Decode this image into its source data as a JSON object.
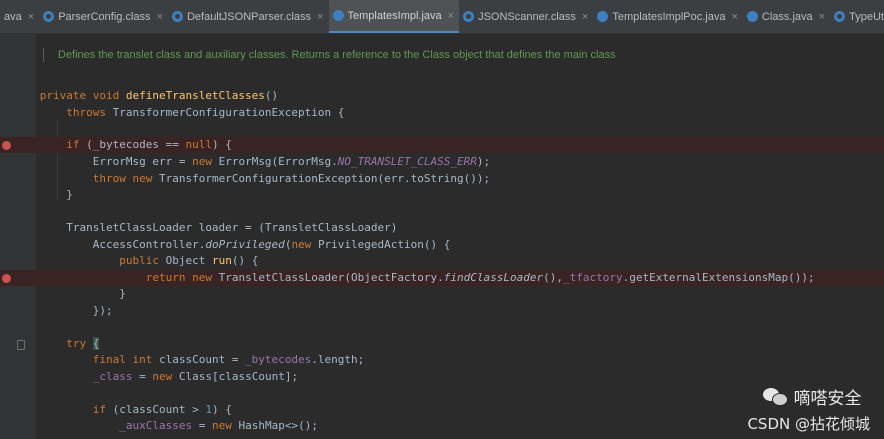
{
  "tabs": [
    {
      "label": "ava",
      "icon": "none",
      "active": false
    },
    {
      "label": "ParserConfig.class",
      "icon": "class-file-icon",
      "active": false
    },
    {
      "label": "DefaultJSONParser.class",
      "icon": "class-file-icon",
      "active": false
    },
    {
      "label": "TemplatesImpl.java",
      "icon": "java-file-icon",
      "active": true
    },
    {
      "label": "JSONScanner.class",
      "icon": "class-file-icon",
      "active": false
    },
    {
      "label": "TemplatesImplPoc.java",
      "icon": "java-file-icon",
      "active": false
    },
    {
      "label": "Class.java",
      "icon": "java-file-icon",
      "active": false
    },
    {
      "label": "TypeUtils.class",
      "icon": "class-file-icon",
      "active": false
    }
  ],
  "close_glyph": "×",
  "doc_comment": "Defines the translet class and auxiliary classes. Returns a reference to the Class object that defines the main class",
  "code": {
    "l1a": "private void ",
    "l1b": "defineTransletClasses",
    "l1c": "()",
    "l2a": "    throws ",
    "l2b": "TransformerConfigurationException {",
    "l3a": "    if ",
    "l3b": "(_bytecodes == ",
    "l3c": "null",
    "l3d": ") {",
    "l4a": "        ErrorMsg err = ",
    "l4b": "new ",
    "l4c": "ErrorMsg(ErrorMsg.",
    "l4d": "NO_TRANSLET_CLASS_ERR",
    "l4e": ");",
    "l5a": "        ",
    "l5b": "throw new ",
    "l5c": "TransformerConfigurationException(err.toString());",
    "l6": "    }",
    "l7": "    TransletClassLoader loader = (TransletClassLoader)",
    "l8a": "        AccessController.",
    "l8b": "doPrivileged",
    "l8c": "(",
    "l8d": "new ",
    "l8e": "PrivilegedAction() {",
    "l9a": "            ",
    "l9b": "public ",
    "l9c": "Object ",
    "l9d": "run",
    "l9e": "() {",
    "l10a": "                ",
    "l10b": "return new ",
    "l10c": "TransletClassLoader(ObjectFactory.",
    "l10d": "findClassLoader",
    "l10e": "(),",
    "l10f": "_tfactory",
    "l10g": ".getExternalExtensionsMap());",
    "l11": "            }",
    "l12": "        });",
    "l13a": "    ",
    "l13b": "try ",
    "l13c": "{",
    "l14a": "        ",
    "l14b": "final int ",
    "l14c": "classCount = ",
    "l14d": "_bytecodes",
    "l14e": ".length;",
    "l15a": "        ",
    "l15b": "_class",
    "l15c": " = ",
    "l15d": "new ",
    "l15e": "Class[classCount];",
    "l16a": "        ",
    "l16b": "if ",
    "l16c": "(classCount > ",
    "l16d": "1",
    "l16e": ") {",
    "l17a": "            ",
    "l17b": "_auxClasses",
    "l17c": " = ",
    "l17d": "new ",
    "l17e": "HashMap<>();"
  },
  "watermark": {
    "line1": "嘀嗒安全",
    "line2": "CSDN @拈花倾城"
  },
  "colors": {
    "keyword": "#cc7832",
    "method_decl": "#ffc66d",
    "field": "#9876aa",
    "number": "#6897bb",
    "comment": "#629755",
    "text": "#a9b7c6",
    "breakpoint": "#c75450"
  }
}
